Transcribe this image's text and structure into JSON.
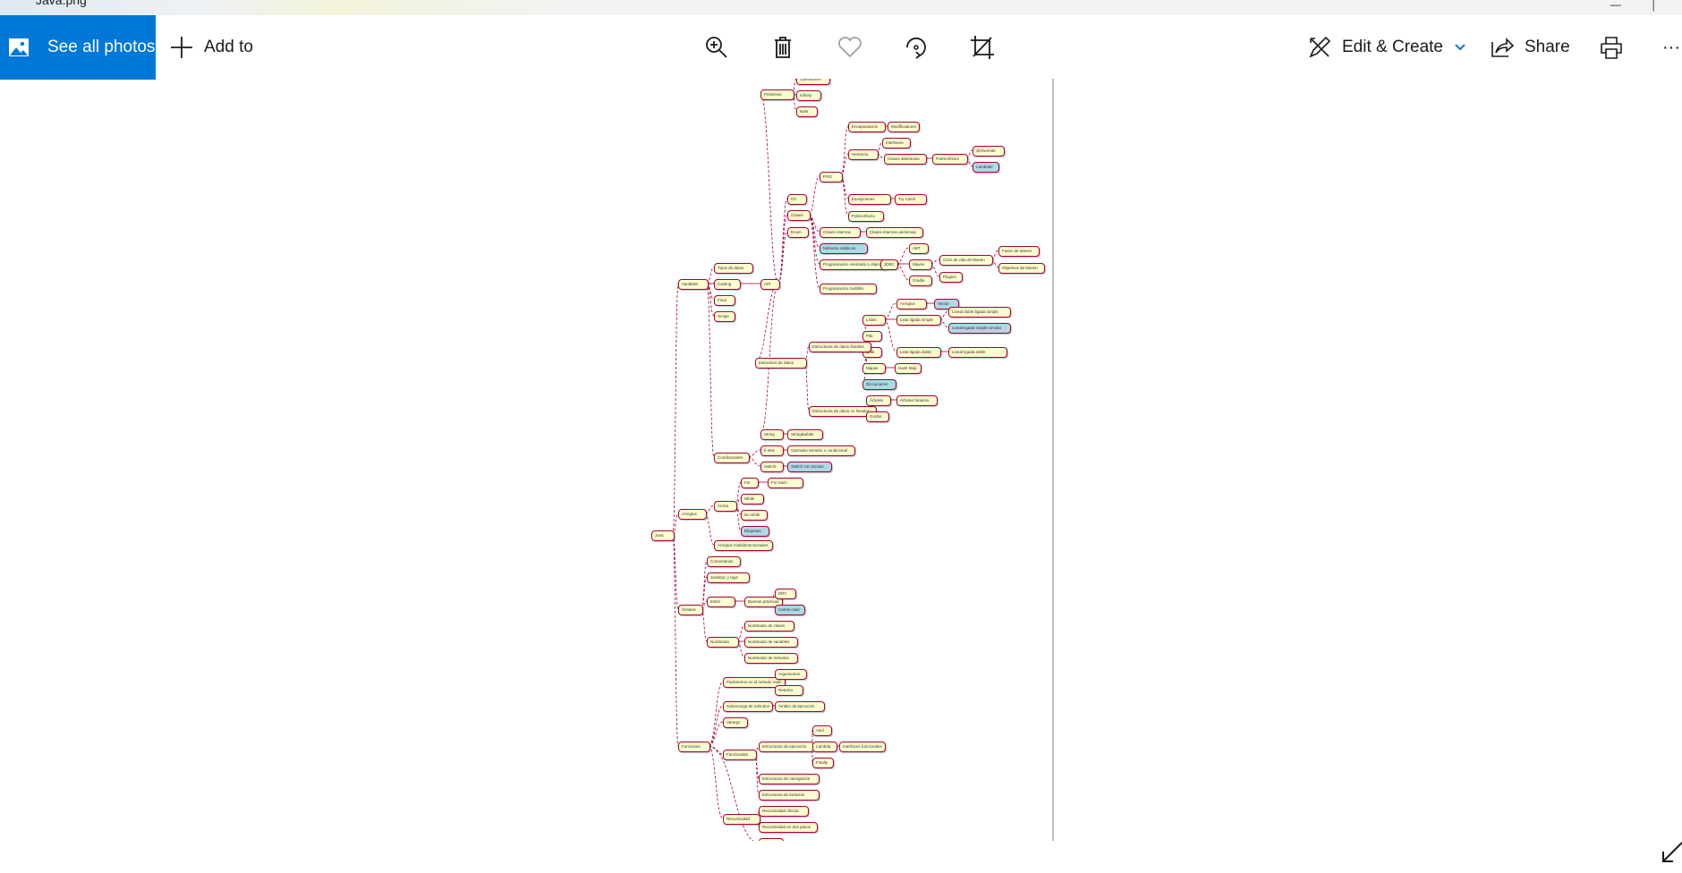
{
  "window": {
    "title": "Java.png"
  },
  "toolbar": {
    "see_all_photos": "See all photos",
    "add_to": "Add to",
    "zoom_icon": "zoom-in-icon",
    "delete_icon": "trash-icon",
    "favorite_icon": "heart-icon",
    "rotate_icon": "rotate-icon",
    "crop_icon": "crop-icon",
    "edit_create": "Edit & Create",
    "share": "Share",
    "print_icon": "printer-icon",
    "more": "···"
  },
  "colors": {
    "accent": "#0078d7",
    "node_fill": "#fefece",
    "node_fill_highlight": "#add8e6",
    "node_border": "#a80036",
    "link": "#a80036"
  },
  "mindmap": {
    "root": "Java",
    "nodes": [
      {
        "id": "primitivos",
        "label": "Primitivos"
      },
      {
        "id": "operadores",
        "label": "Operadores"
      },
      {
        "id": "infinity",
        "label": "Infinity"
      },
      {
        "id": "nan",
        "label": "NaN"
      },
      {
        "id": "encapsulacion",
        "label": "Encapsulación"
      },
      {
        "id": "modificadores",
        "label": "Modificadores"
      },
      {
        "id": "herencia",
        "label": "Herencia"
      },
      {
        "id": "interfaces",
        "label": "Interfaces"
      },
      {
        "id": "clases_abstractas",
        "label": "Clases abstractas"
      },
      {
        "id": "polimorfismo",
        "label": "Polimorfismo"
      },
      {
        "id": "override",
        "label": "@Override"
      },
      {
        "id": "lambdas",
        "label": "Lambdas"
      },
      {
        "id": "poo",
        "label": "POO"
      },
      {
        "id": "excepciones",
        "label": "Excepciones"
      },
      {
        "id": "try_catch",
        "label": "Try Catch"
      },
      {
        "id": "polimorfismo2",
        "label": "Polimorfismo"
      },
      {
        "id": "io",
        "label": "I/O"
      },
      {
        "id": "clases",
        "label": "Clases"
      },
      {
        "id": "enum",
        "label": "Enum"
      },
      {
        "id": "clases_internas",
        "label": "Clases internas"
      },
      {
        "id": "clases_internas_anonimas",
        "label": "Clases internas anónimas"
      },
      {
        "id": "metodos_estaticos",
        "label": "Métodos estáticos"
      },
      {
        "id": "programacion_orientada",
        "label": "Programación orientada a objetos"
      },
      {
        "id": "jdbc",
        "label": "JDBC"
      },
      {
        "id": "abt",
        "label": "ABT"
      },
      {
        "id": "maven",
        "label": "Maven"
      },
      {
        "id": "ciclo_vida_maven",
        "label": "Ciclo de vida de Maven"
      },
      {
        "id": "fases_maven",
        "label": "Fases de Maven"
      },
      {
        "id": "objetivos_maven",
        "label": "Objetivos de Maven"
      },
      {
        "id": "plugins",
        "label": "Plugins"
      },
      {
        "id": "gradle",
        "label": "Gradle"
      },
      {
        "id": "programacion_multihilo",
        "label": "Programación multihilo"
      },
      {
        "id": "tipos_datos",
        "label": "Tipos de datos"
      },
      {
        "id": "variables",
        "label": "Variables"
      },
      {
        "id": "casting",
        "label": "Casting"
      },
      {
        "id": "final",
        "label": "Final"
      },
      {
        "id": "scope",
        "label": "Scope"
      },
      {
        "id": "api",
        "label": "API"
      },
      {
        "id": "arreglos",
        "label": "Arreglos"
      },
      {
        "id": "vector",
        "label": "Vector"
      },
      {
        "id": "listas",
        "label": "Listas"
      },
      {
        "id": "lista_ligada_simple",
        "label": "Lista ligada simple"
      },
      {
        "id": "lineales_simple",
        "label": "Lineal doble ligada simple"
      },
      {
        "id": "lineales_circular",
        "label": "Lineal ligada simple circular"
      },
      {
        "id": "pila",
        "label": "Pila"
      },
      {
        "id": "lista_ligada_doble",
        "label": "Lista ligada doble"
      },
      {
        "id": "lineal_doble",
        "label": "Lineal ligada doble"
      },
      {
        "id": "cola",
        "label": "Cola"
      },
      {
        "id": "estructuras_lineales",
        "label": "Estructuras de datos lineales"
      },
      {
        "id": "estructura_datos",
        "label": "Estructura de datos"
      },
      {
        "id": "mapas",
        "label": "Mapas"
      },
      {
        "id": "hashmap",
        "label": "Hash Map"
      },
      {
        "id": "diccionarios",
        "label": "Diccionarios"
      },
      {
        "id": "arboles",
        "label": "Árboles"
      },
      {
        "id": "arboles_binarios",
        "label": "Árboles binarios"
      },
      {
        "id": "estructuras_no_lineales",
        "label": "Estructuras de datos no lineales"
      },
      {
        "id": "grafos",
        "label": "Grafos"
      },
      {
        "id": "string",
        "label": "String"
      },
      {
        "id": "stringbuilder",
        "label": "StringBuilder"
      },
      {
        "id": "if_else",
        "label": "If else"
      },
      {
        "id": "condicionales",
        "label": "Condicionales"
      },
      {
        "id": "operador_ternario",
        "label": "Operador ternario o condicional"
      },
      {
        "id": "switch",
        "label": "Switch"
      },
      {
        "id": "switch_arrows",
        "label": "Switch con arrows"
      },
      {
        "id": "for",
        "label": "For"
      },
      {
        "id": "for_each",
        "label": "For each"
      },
      {
        "id": "while",
        "label": "While"
      },
      {
        "id": "do_while",
        "label": "Do while"
      },
      {
        "id": "ciclos",
        "label": "Ciclos"
      },
      {
        "id": "etiquetas",
        "label": "Etiquetas"
      },
      {
        "id": "arrays",
        "label": "Arreglos"
      },
      {
        "id": "arreglos_multi",
        "label": "Arreglos multidimensionales"
      },
      {
        "id": "comentarios",
        "label": "Comentarios"
      },
      {
        "id": "javadoc",
        "label": "JavaDoc y tags"
      },
      {
        "id": "estilo",
        "label": "Estilo"
      },
      {
        "id": "buenas_practicas",
        "label": "Buenas prácticas"
      },
      {
        "id": "sintaxis",
        "label": "Sintaxis"
      },
      {
        "id": "dry",
        "label": "DRY"
      },
      {
        "id": "nombrado",
        "label": "Nombrado"
      },
      {
        "id": "camelcase",
        "label": "Camel case"
      },
      {
        "id": "nombrado_clases",
        "label": "Nombrado de clases"
      },
      {
        "id": "nombrado_variables",
        "label": "Nombrado de variables"
      },
      {
        "id": "nombrado_metodos",
        "label": "Nombrado de métodos"
      },
      {
        "id": "argumentos",
        "label": "Argumentos"
      },
      {
        "id": "parametros_main",
        "label": "Parámetros en el método main"
      },
      {
        "id": "retorno",
        "label": "Retorno"
      },
      {
        "id": "sobrecarga",
        "label": "Sobrecarga de métodos"
      },
      {
        "id": "ambito",
        "label": "Ámbito de ejecución"
      },
      {
        "id": "varargs",
        "label": "Varargs"
      },
      {
        "id": "estructuras_ejecucion",
        "label": "Estructuras de ejecución"
      },
      {
        "id": "void",
        "label": "Void"
      },
      {
        "id": "funciones",
        "label": "Funciones"
      },
      {
        "id": "funcionales",
        "label": "Funcionales"
      },
      {
        "id": "lambda",
        "label": "Lambda"
      },
      {
        "id": "interfaces_func",
        "label": "Interfaces funcionales"
      },
      {
        "id": "finally",
        "label": "Finally"
      },
      {
        "id": "estructuras_navegacion",
        "label": "Estructuras de navegación"
      },
      {
        "id": "estructuras_iteracion",
        "label": "Estructuras de iteración"
      },
      {
        "id": "recursividad",
        "label": "Recursividad"
      },
      {
        "id": "recursividad_directa",
        "label": "Recursividad directa"
      },
      {
        "id": "recursividad_pasos",
        "label": "Recursividad en dos pasos"
      },
      {
        "id": "colas",
        "label": "Colas"
      }
    ]
  }
}
